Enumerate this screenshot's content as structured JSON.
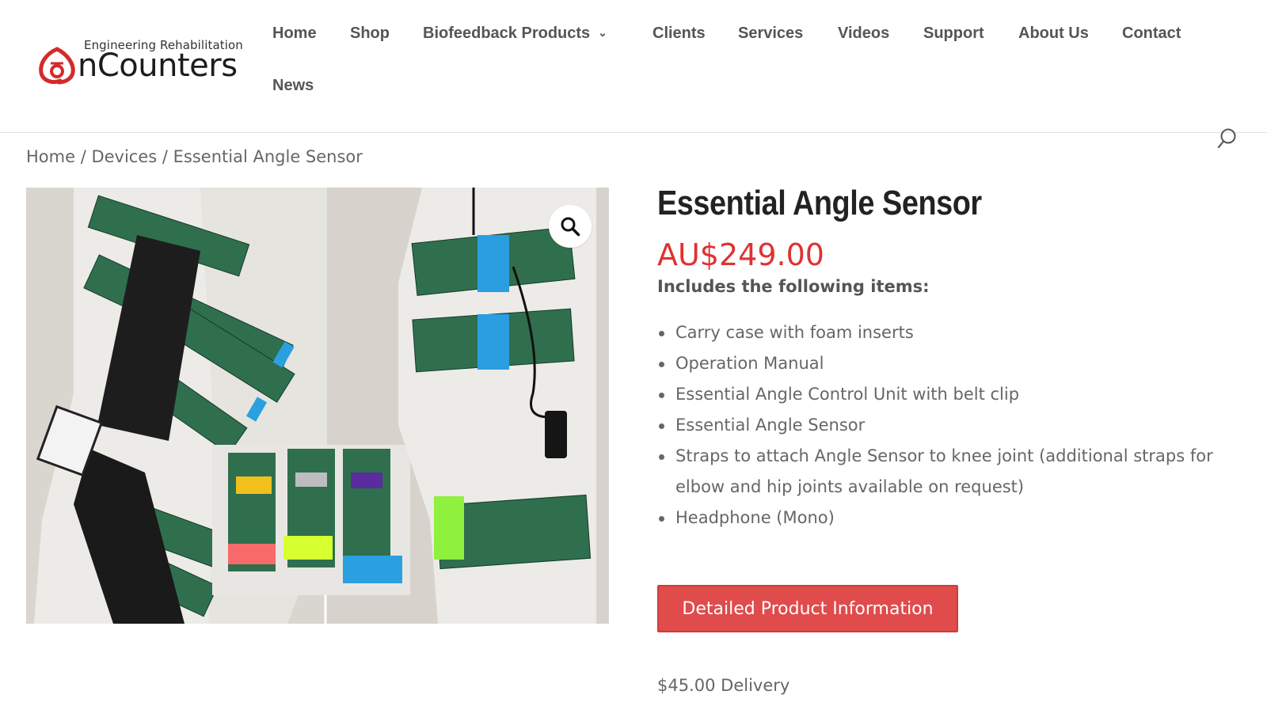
{
  "brand": {
    "tagline": "Engineering Rehabilitation",
    "name": "nCounters",
    "accent_color": "#d42a2a"
  },
  "nav": {
    "items": [
      {
        "label": "Home"
      },
      {
        "label": "Shop"
      },
      {
        "label": "Biofeedback Products",
        "has_dropdown": true
      },
      {
        "label": "Clients"
      },
      {
        "label": "Services"
      },
      {
        "label": "Videos"
      },
      {
        "label": "Support"
      },
      {
        "label": "About Us"
      },
      {
        "label": "Contact"
      },
      {
        "label": "News"
      }
    ],
    "dropdown_icon": "chevron-down-icon",
    "search_icon": "search-icon"
  },
  "breadcrumb": {
    "home": "Home",
    "separator": " / ",
    "category": "Devices",
    "current": "Essential Angle Sensor"
  },
  "gallery": {
    "zoom_icon": "magnifier-icon",
    "zoom_glyph": "🔍"
  },
  "product": {
    "title": "Essential Angle Sensor",
    "price": "AU$249.00",
    "price_color": "#e03131",
    "includes_heading": "Includes the following items:",
    "items": [
      "Carry case with foam inserts",
      "Operation Manual",
      "Essential Angle Control Unit with belt clip",
      "Essential Angle Sensor",
      "Straps to attach Angle Sensor to knee joint (additional straps for elbow and hip joints available on request)",
      "Headphone (Mono)"
    ],
    "cta_label": "Detailed Product Information",
    "cta_color": "#e04b4b",
    "delivery": "$45.00 Delivery"
  }
}
